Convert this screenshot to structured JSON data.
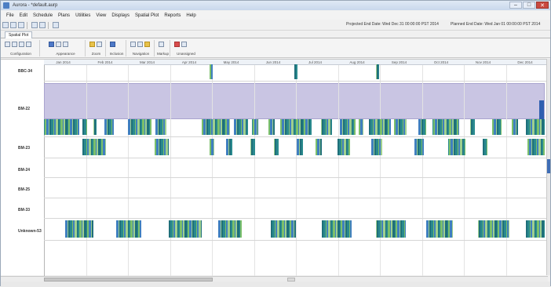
{
  "window": {
    "title": "Aurora - *default.aurp"
  },
  "menu": [
    "File",
    "Edit",
    "Schedule",
    "Plans",
    "Utilities",
    "View",
    "Displays",
    "Spatial Plot",
    "Reports",
    "Help"
  ],
  "header": {
    "projected_end": "Projected End Date: Wed Dec 31 00:00:00 PST 2014",
    "planned_end": "Planned End Date: Wed Jan 01 00:00:00 PST 2014"
  },
  "tabs": [
    "Spatial Plot"
  ],
  "ribbon": {
    "groups": [
      {
        "label": "Configuration",
        "icons": [
          "gear-icon",
          "grid-icon",
          "table-icon",
          "edit-icon"
        ]
      },
      {
        "label": "Appearance",
        "icons": [
          "palette-icon",
          "shape-icon",
          "color-icon"
        ]
      },
      {
        "label": "Zoom",
        "icons": [
          "zoom-in-icon",
          "zoom-out-icon"
        ]
      },
      {
        "label": "Inclusion",
        "icons": [
          "filter-icon"
        ]
      },
      {
        "label": "Navigation",
        "icons": [
          "back-icon",
          "forward-icon",
          "star-icon"
        ]
      },
      {
        "label": "Markup",
        "icons": [
          "markup-icon"
        ]
      },
      {
        "label": "Unassigned",
        "icons": [
          "warning-icon",
          "pin-icon"
        ]
      }
    ]
  },
  "timeline": {
    "months": [
      "Jan 2014",
      "Feb 2014",
      "Mar 2014",
      "Apr 2014",
      "May 2014",
      "Jun 2014",
      "Jul 2014",
      "Aug 2014",
      "Sep 2014",
      "Oct 2014",
      "Nov 2014",
      "Dec 2014"
    ]
  },
  "rows": [
    "BBC-34",
    "BM-22",
    "BM-23",
    "BM-24",
    "BM-25",
    "BM-33",
    "Unknown-53"
  ],
  "colors": {
    "bar_teal": "#2a8a8e",
    "bar_green": "#7bbf6a",
    "bar_blue": "#3f7fbf",
    "band_purple": "#c9c5e3",
    "accent": "#3e6db5"
  }
}
